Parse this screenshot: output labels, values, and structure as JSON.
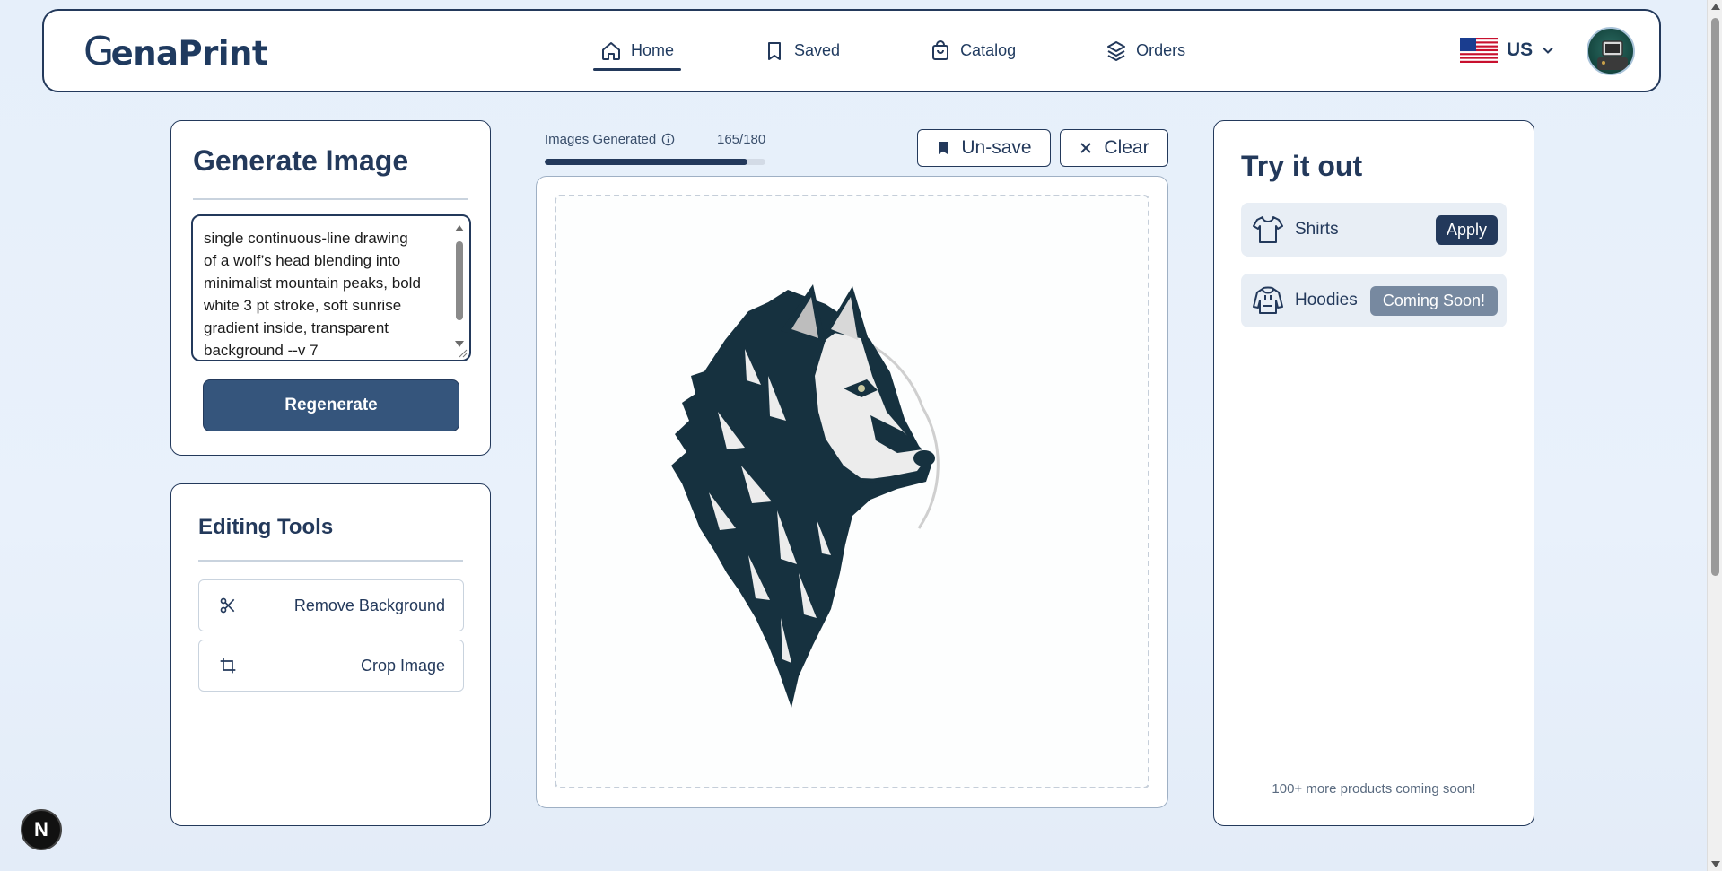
{
  "app": {
    "logo_initial": "G",
    "logo_rest": "enaPrint"
  },
  "nav": {
    "items": [
      {
        "label": "Home",
        "icon": "home-icon",
        "active": true
      },
      {
        "label": "Saved",
        "icon": "bookmark-icon",
        "active": false
      },
      {
        "label": "Catalog",
        "icon": "shopping-bag-icon",
        "active": false
      },
      {
        "label": "Orders",
        "icon": "boxes-icon",
        "active": false
      }
    ]
  },
  "region": {
    "flag_icon": "us-flag-icon",
    "label": "US"
  },
  "generate": {
    "title": "Generate Image",
    "prompt": "single continuous-line drawing\nof a wolf’s head blending into\nminimalist mountain peaks, bold\nwhite 3 pt stroke, soft sunrise\ngradient inside, transparent\nbackground --v 7",
    "button_label": "Regenerate"
  },
  "editing_tools": {
    "title": "Editing Tools",
    "tools": [
      {
        "label": "Remove Background",
        "icon": "scissors-icon"
      },
      {
        "label": "Crop Image",
        "icon": "crop-icon"
      }
    ]
  },
  "usage": {
    "label": "Images Generated",
    "count_text": "165/180",
    "used": 165,
    "limit": 180
  },
  "canvas_actions": {
    "unsave_label": "Un-save",
    "clear_label": "Clear"
  },
  "canvas": {
    "image_icon": "wolf-head-icon"
  },
  "try_it": {
    "title": "Try it out",
    "products": [
      {
        "label": "Shirts",
        "icon": "shirt-icon",
        "button": "Apply"
      },
      {
        "label": "Hoodies",
        "icon": "hoodie-icon",
        "button": "Coming Soon!"
      }
    ],
    "footer": "100+ more products coming soon!"
  },
  "dev_badge": "N",
  "colors": {
    "primary": "#23395b",
    "button": "#35557c",
    "disabled": "#7789a0",
    "background": "#e6effa"
  }
}
